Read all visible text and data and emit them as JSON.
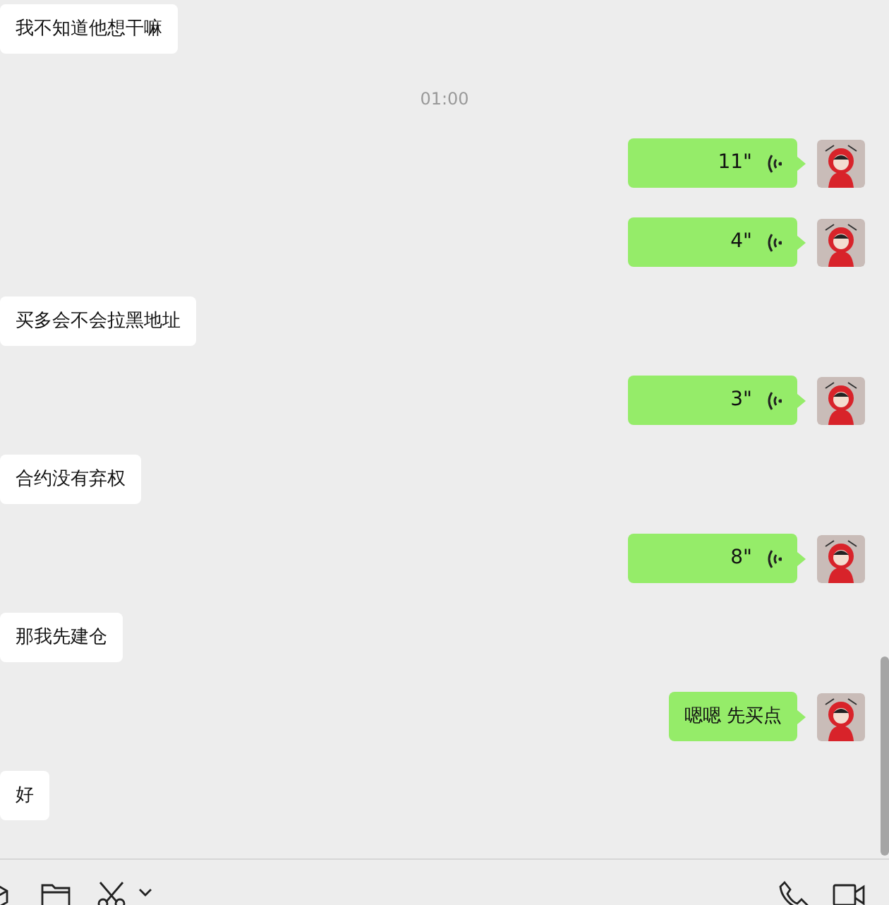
{
  "messages": [
    {
      "kind": "text",
      "sent": false,
      "text": "我不知道他想干嘛"
    },
    {
      "kind": "time",
      "text": "01:00"
    },
    {
      "kind": "voice",
      "sent": true,
      "text": "11\""
    },
    {
      "kind": "voice",
      "sent": true,
      "text": "4\""
    },
    {
      "kind": "text",
      "sent": false,
      "text": "买多会不会拉黑地址"
    },
    {
      "kind": "voice",
      "sent": true,
      "text": "3\""
    },
    {
      "kind": "text",
      "sent": false,
      "text": "合约没有弃权"
    },
    {
      "kind": "voice",
      "sent": true,
      "text": "8\""
    },
    {
      "kind": "text",
      "sent": false,
      "text": "那我先建仓"
    },
    {
      "kind": "text",
      "sent": true,
      "text": "嗯嗯 先买点"
    },
    {
      "kind": "text",
      "sent": false,
      "text": "好"
    }
  ]
}
